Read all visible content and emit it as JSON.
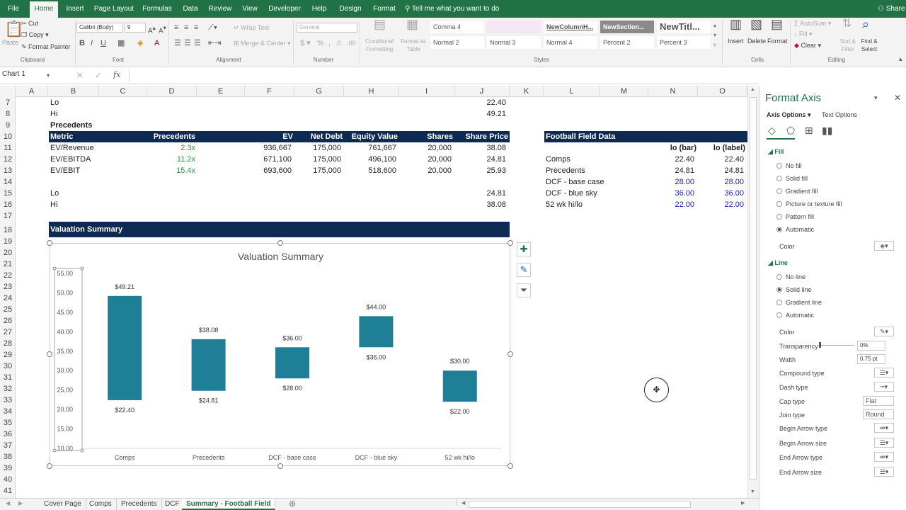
{
  "ribbon_tabs": [
    "File",
    "Home",
    "Insert",
    "Page Layout",
    "Formulas",
    "Data",
    "Review",
    "View",
    "Developer",
    "Help",
    "Design",
    "Format"
  ],
  "tell_me": "Tell me what you want to do",
  "share": "Share",
  "clipboard": {
    "paste": "Paste",
    "cut": "Cut",
    "copy": "Copy",
    "format_painter": "Format Painter",
    "group": "Clipboard"
  },
  "font": {
    "name": "Calibri (Body)",
    "size": "9",
    "group": "Font"
  },
  "alignment": {
    "wrap_text": "Wrap Text",
    "merge_center": "Merge & Center",
    "group": "Alignment"
  },
  "number": {
    "format": "General",
    "group": "Number"
  },
  "styles": {
    "conditional": "Conditional Formatting",
    "format_as_table": "Format as Table",
    "row1": [
      "Comma 4",
      "",
      "NewColumnH...",
      "NewSection...",
      "NewTitl..."
    ],
    "row2": [
      "Normal 2",
      "Normal 3",
      "Normal 4",
      "Percent 2",
      "Percent 3"
    ],
    "group": "Styles"
  },
  "cells": {
    "insert": "Insert",
    "delete": "Delete",
    "format": "Format",
    "group": "Cells"
  },
  "editing": {
    "autosum": "AutoSum",
    "fill": "Fill",
    "clear": "Clear",
    "sort_filter": "Sort & Filter",
    "find_select": "Find & Select",
    "group": "Editing"
  },
  "name_box": "Chart 1",
  "fx": "fx",
  "columns": [
    "A",
    "B",
    "C",
    "D",
    "E",
    "F",
    "G",
    "H",
    "I",
    "J",
    "K",
    "L",
    "M",
    "N",
    "O"
  ],
  "rows": [
    "7",
    "8",
    "9",
    "10",
    "11",
    "12",
    "13",
    "14",
    "15",
    "16",
    "17",
    "18",
    "19",
    "20",
    "21",
    "22",
    "23",
    "24",
    "25",
    "26",
    "27",
    "28",
    "29",
    "30",
    "31",
    "32",
    "33",
    "34",
    "35",
    "36",
    "37",
    "38",
    "39",
    "40",
    "41"
  ],
  "sheet": {
    "lo_label": "Lo",
    "lo_value": "22.40",
    "hi_label": "Hi",
    "hi_value": "49.21",
    "precedents_title": "Precedents",
    "table_headers": [
      "Metric",
      "Precedents",
      "EV",
      "Net Debt",
      "Equity Value",
      "Shares",
      "Share Price"
    ],
    "table_rows": [
      [
        "EV/Revenue",
        "2.3x",
        "936,667",
        "175,000",
        "761,667",
        "20,000",
        "38.08"
      ],
      [
        "EV/EBITDA",
        "11.2x",
        "671,100",
        "175,000",
        "496,100",
        "20,000",
        "24.81"
      ],
      [
        "EV/EBIT",
        "15.4x",
        "693,600",
        "175,000",
        "518,600",
        "20,000",
        "25.93"
      ]
    ],
    "lo2_label": "Lo",
    "lo2_value": "24.81",
    "hi2_label": "Hi",
    "hi2_value": "38.08",
    "football_title": "Football Field Data",
    "ff_headers": [
      "lo (bar)",
      "lo  (label)"
    ],
    "ff_rows": [
      [
        "Comps",
        "22.40",
        "22.40"
      ],
      [
        "Precedents",
        "24.81",
        "24.81"
      ],
      [
        "DCF - base case",
        "28.00",
        "28.00"
      ],
      [
        "DCF - blue sky",
        "36.00",
        "36.00"
      ],
      [
        "52 wk hi/lo",
        "22.00",
        "22.00"
      ]
    ],
    "valuation_banner": "Valuation Summary"
  },
  "chart_data": {
    "type": "bar",
    "title": "Valuation Summary",
    "categories": [
      "Comps",
      "Precedents",
      "DCF - base case",
      "DCF - blue sky",
      "52 wk hi/lo"
    ],
    "low": [
      22.4,
      24.81,
      28.0,
      36.0,
      22.0
    ],
    "high": [
      49.21,
      38.08,
      36.0,
      44.0,
      30.0
    ],
    "low_labels": [
      "$22.40",
      "$24.81",
      "$28.00",
      "$36.00",
      "$22.00"
    ],
    "high_labels": [
      "$49.21",
      "$38.08",
      "$36.00",
      "$44.00",
      "$30.00"
    ],
    "yticks": [
      "55.00",
      "50.00",
      "45.00",
      "40.00",
      "35.00",
      "30.00",
      "25.00",
      "20.00",
      "15.00",
      "10.00"
    ],
    "ylim": [
      10,
      55
    ],
    "bar_color": "#1f7f96"
  },
  "pane": {
    "title": "Format Axis",
    "tab_axis": "Axis Options",
    "tab_text": "Text Options",
    "fill_header": "Fill",
    "fill_options": [
      "No fill",
      "Solid fill",
      "Gradient fill",
      "Picture or texture fill",
      "Pattern fill",
      "Automatic"
    ],
    "color_label": "Color",
    "line_header": "Line",
    "line_options": [
      "No line",
      "Solid line",
      "Gradient line",
      "Automatic"
    ],
    "line_color": "Color",
    "transparency": "Transparency",
    "transparency_value": "0%",
    "width": "Width",
    "width_value": "0.75 pt",
    "compound": "Compound type",
    "dash": "Dash type",
    "cap": "Cap type",
    "cap_value": "Flat",
    "join": "Join type",
    "join_value": "Round",
    "begin_arrow_type": "Begin Arrow type",
    "begin_arrow_size": "Begin Arrow size",
    "end_arrow_type": "End Arrow type",
    "end_arrow_size": "End Arrow size"
  },
  "sheet_tabs": [
    "Cover Page",
    "Comps",
    "Precedents",
    "DCF",
    "Summary - Football Field"
  ],
  "colors": {
    "excel_green": "#217346",
    "navy": "#0f2a52",
    "bar": "#1f7f96"
  }
}
